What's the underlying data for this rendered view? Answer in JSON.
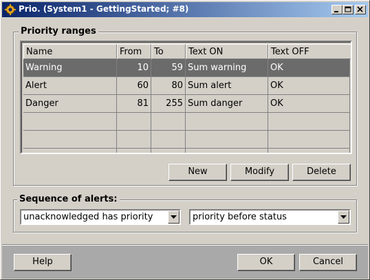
{
  "window": {
    "title": "Prio. (System1 - GettingStarted; #8)",
    "title_colors": {
      "start": "#0a246a",
      "end": "#a6caf0"
    },
    "controls": [
      "minimize-icon",
      "maximize-icon",
      "close-icon"
    ]
  },
  "priority_ranges": {
    "label": "Priority ranges",
    "columns": [
      "Name",
      "From",
      "To",
      "Text ON",
      "Text OFF"
    ],
    "rows": [
      {
        "name": "Warning",
        "from": "10",
        "to": "59",
        "text_on": "Sum warning",
        "text_off": "OK",
        "selected": true
      },
      {
        "name": "Alert",
        "from": "60",
        "to": "80",
        "text_on": "Sum alert",
        "text_off": "OK",
        "selected": false
      },
      {
        "name": "Danger",
        "from": "81",
        "to": "255",
        "text_on": "Sum danger",
        "text_off": "OK",
        "selected": false
      }
    ],
    "buttons": {
      "new": "New",
      "modify": "Modify",
      "delete": "Delete"
    }
  },
  "sequence": {
    "label": "Sequence of alerts:",
    "combo1_value": "unacknowledged has priority",
    "combo2_value": "priority before status"
  },
  "footer": {
    "help": "Help",
    "ok": "OK",
    "cancel": "Cancel"
  },
  "colors": {
    "selected_row": "#6b6b6b",
    "dialog": "#d4d0c8",
    "footer": "#a9a9a9"
  }
}
